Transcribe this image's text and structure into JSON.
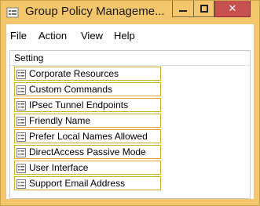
{
  "window": {
    "title": "Group Policy Manageme...",
    "controls": {
      "minimize": "minimize",
      "maximize": "maximize",
      "close": "✕"
    }
  },
  "menu": {
    "file": "File",
    "action": "Action",
    "view": "View",
    "help": "Help"
  },
  "list": {
    "column_header": "Setting",
    "items": [
      "Corporate Resources",
      "Custom Commands",
      "IPsec Tunnel Endpoints",
      "Friendly Name",
      "Prefer Local Names Allowed",
      "DirectAccess Passive Mode",
      "User Interface",
      "Support Email Address"
    ]
  },
  "colors": {
    "title_bar": "#f3c66b",
    "close_button": "#c75050",
    "row_border": "#dcab2e"
  }
}
